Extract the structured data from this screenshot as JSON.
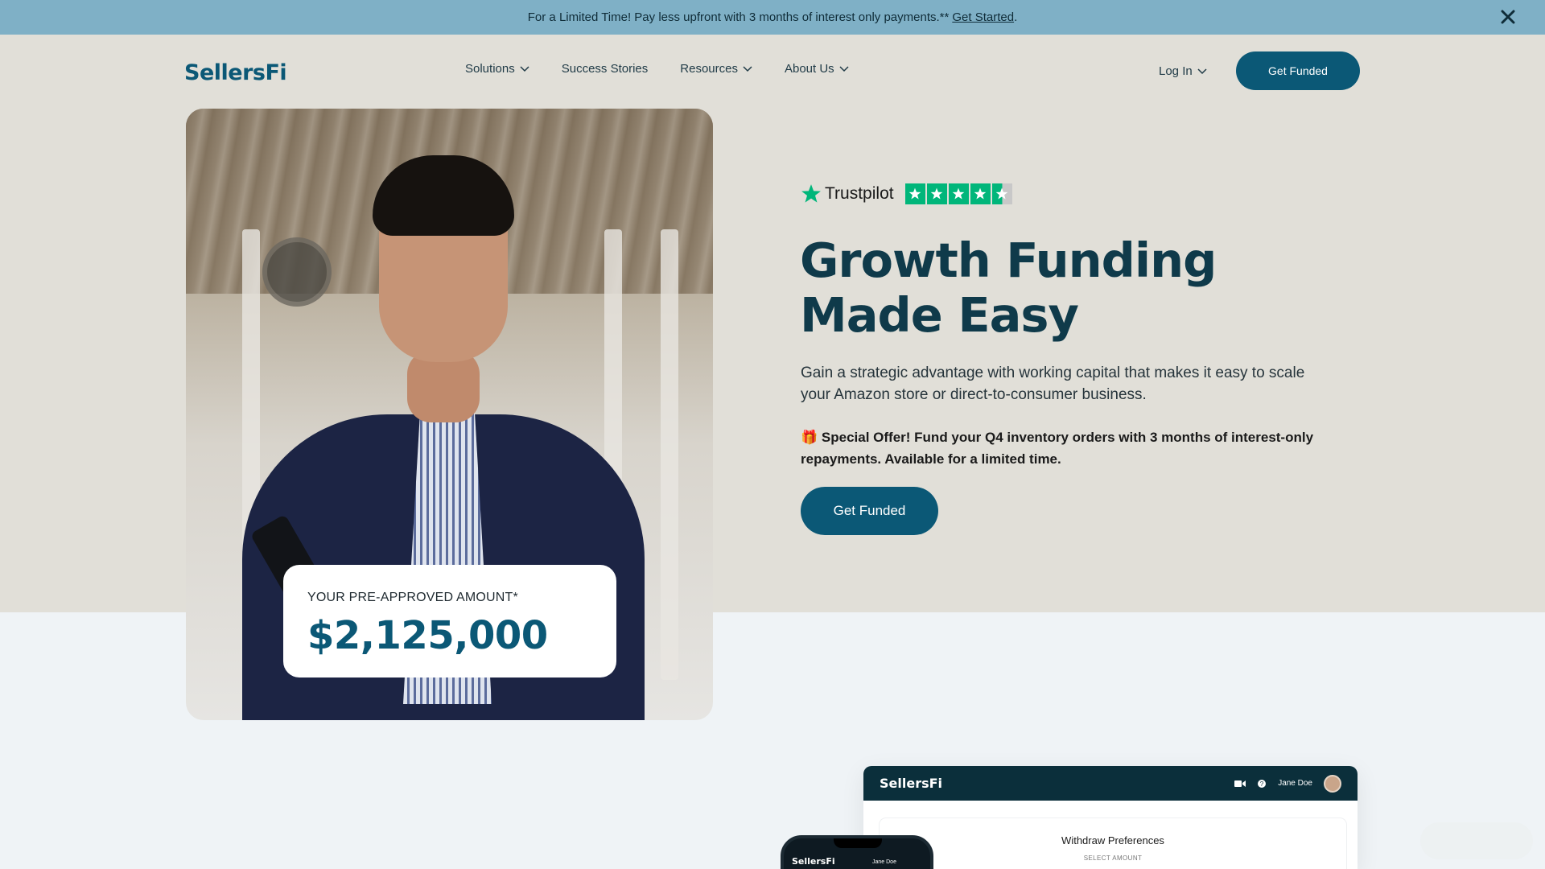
{
  "announcement": {
    "text": "For a Limited Time! Pay less upfront with 3 months of interest only payments.**",
    "link": "Get Started",
    "suffix": "."
  },
  "header": {
    "logo": "SellersFi",
    "nav": [
      {
        "label": "Solutions",
        "has_dropdown": true
      },
      {
        "label": "Success Stories",
        "has_dropdown": false
      },
      {
        "label": "Resources",
        "has_dropdown": true
      },
      {
        "label": "About Us",
        "has_dropdown": true
      }
    ],
    "login": "Log In",
    "cta": "Get Funded"
  },
  "hero": {
    "trustpilot": "Trustpilot",
    "trustpilot_rating": 4.5,
    "headline_line1": "Growth Funding",
    "headline_line2": "Made Easy",
    "subtext": "Gain a strategic advantage with working capital that makes it easy to scale your Amazon store or direct-to-consumer business.",
    "offer_icon": "🎁",
    "offer": "Special Offer! Fund your Q4 inventory orders with 3 months of interest-only repayments. Available for a limited time.",
    "cta": "Get Funded",
    "preapproved_label": "YOUR PRE-APPROVED AMOUNT*",
    "preapproved_amount": "$2,125,000"
  },
  "dashboard": {
    "logo": "SellersFi",
    "user": "Jane Doe",
    "card_title": "Withdraw Preferences",
    "card_sub": "SELECT AMOUNT"
  },
  "phone": {
    "logo": "SellersFi",
    "user": "Jane Doe"
  },
  "colors": {
    "brand": "#0b5876",
    "announce_bg": "#7fb0c6",
    "hero_bg": "#e1dfd8",
    "trustpilot_green": "#00b67a"
  }
}
